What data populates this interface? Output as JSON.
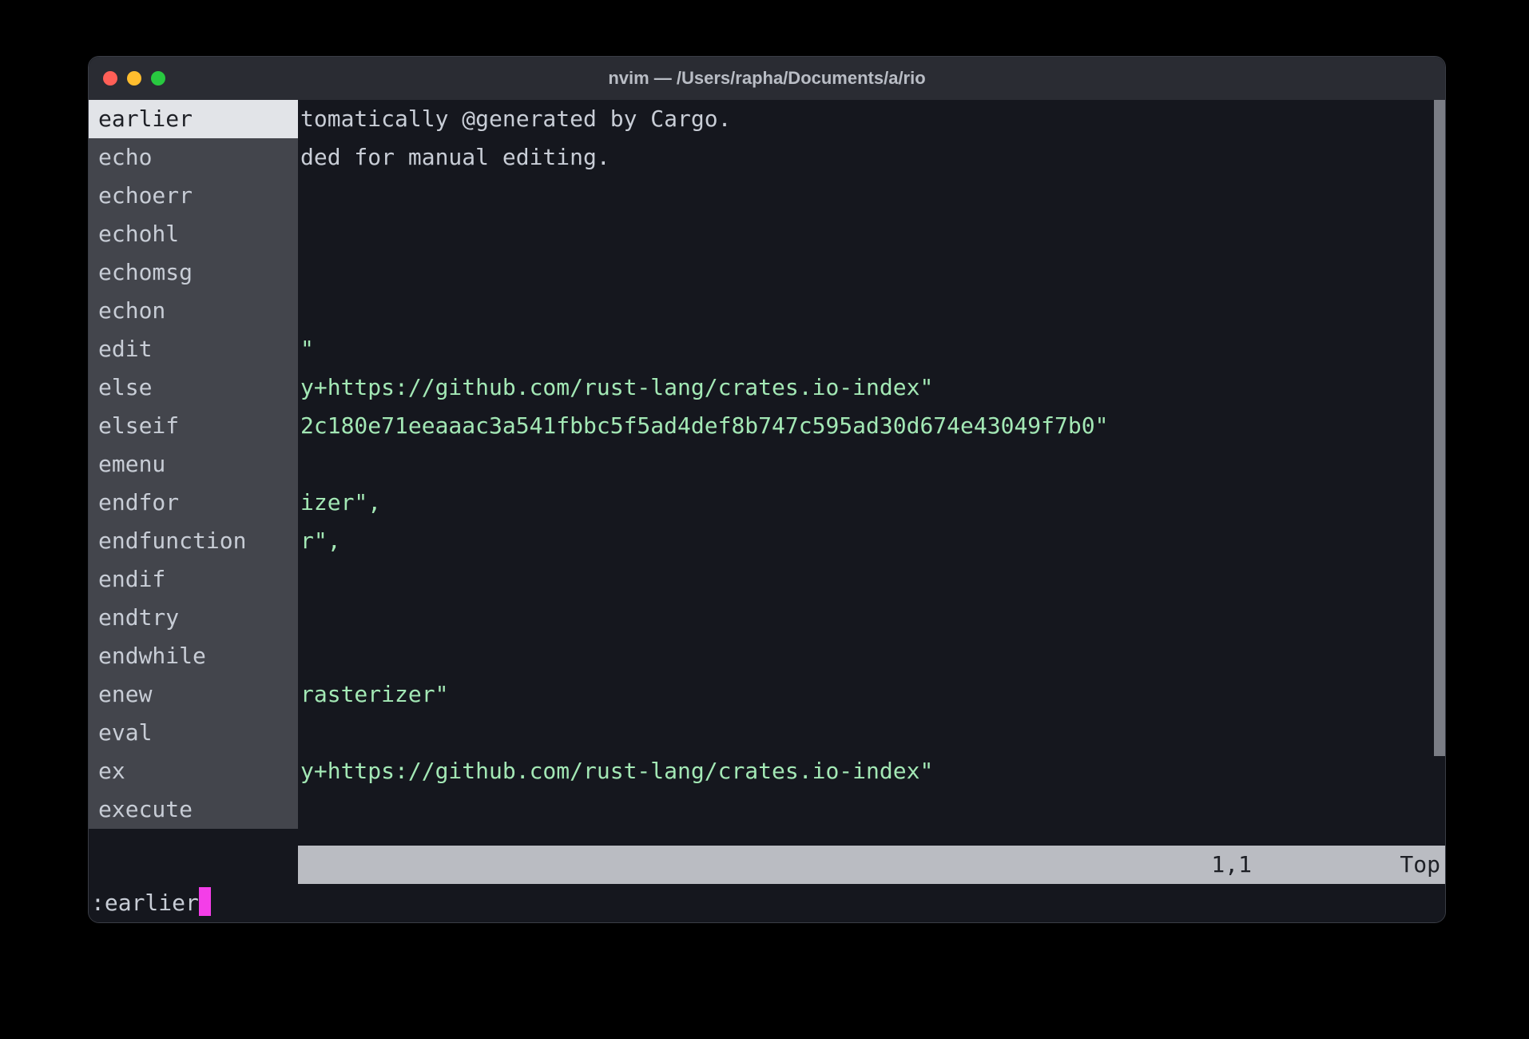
{
  "window": {
    "title": "nvim — /Users/rapha/Documents/a/rio"
  },
  "completion": {
    "selected_index": 0,
    "items": [
      "earlier",
      "echo",
      "echoerr",
      "echohl",
      "echomsg",
      "echon",
      "edit",
      "else",
      "elseif",
      "emenu",
      "endfor",
      "endfunction",
      "endif",
      "endtry",
      "endwhile",
      "enew",
      "eval",
      "ex",
      "execute"
    ]
  },
  "editor": {
    "lines": [
      {
        "text": "tomatically @generated by Cargo.",
        "style": "plain"
      },
      {
        "text": "ded for manual editing.",
        "style": "plain"
      },
      {
        "text": "",
        "style": "plain"
      },
      {
        "text": "",
        "style": "plain"
      },
      {
        "text": "",
        "style": "plain"
      },
      {
        "text": "",
        "style": "plain"
      },
      {
        "text": "\"",
        "style": "green"
      },
      {
        "text": "y+https://github.com/rust-lang/crates.io-index\"",
        "style": "green"
      },
      {
        "text": "2c180e71eeaaac3a541fbbc5f5ad4def8b747c595ad30d674e43049f7b0\"",
        "style": "green"
      },
      {
        "text": "",
        "style": "plain"
      },
      {
        "text": "izer\",",
        "style": "green"
      },
      {
        "text": "r\",",
        "style": "green"
      },
      {
        "text": "",
        "style": "plain"
      },
      {
        "text": "",
        "style": "plain"
      },
      {
        "text": "",
        "style": "plain"
      },
      {
        "text": "rasterizer\"",
        "style": "green"
      },
      {
        "text": "",
        "style": "plain"
      },
      {
        "text": "y+https://github.com/rust-lang/crates.io-index\"",
        "style": "green"
      }
    ]
  },
  "status": {
    "position": "1,1",
    "scroll": "Top"
  },
  "command": {
    "text": ":earlier"
  }
}
